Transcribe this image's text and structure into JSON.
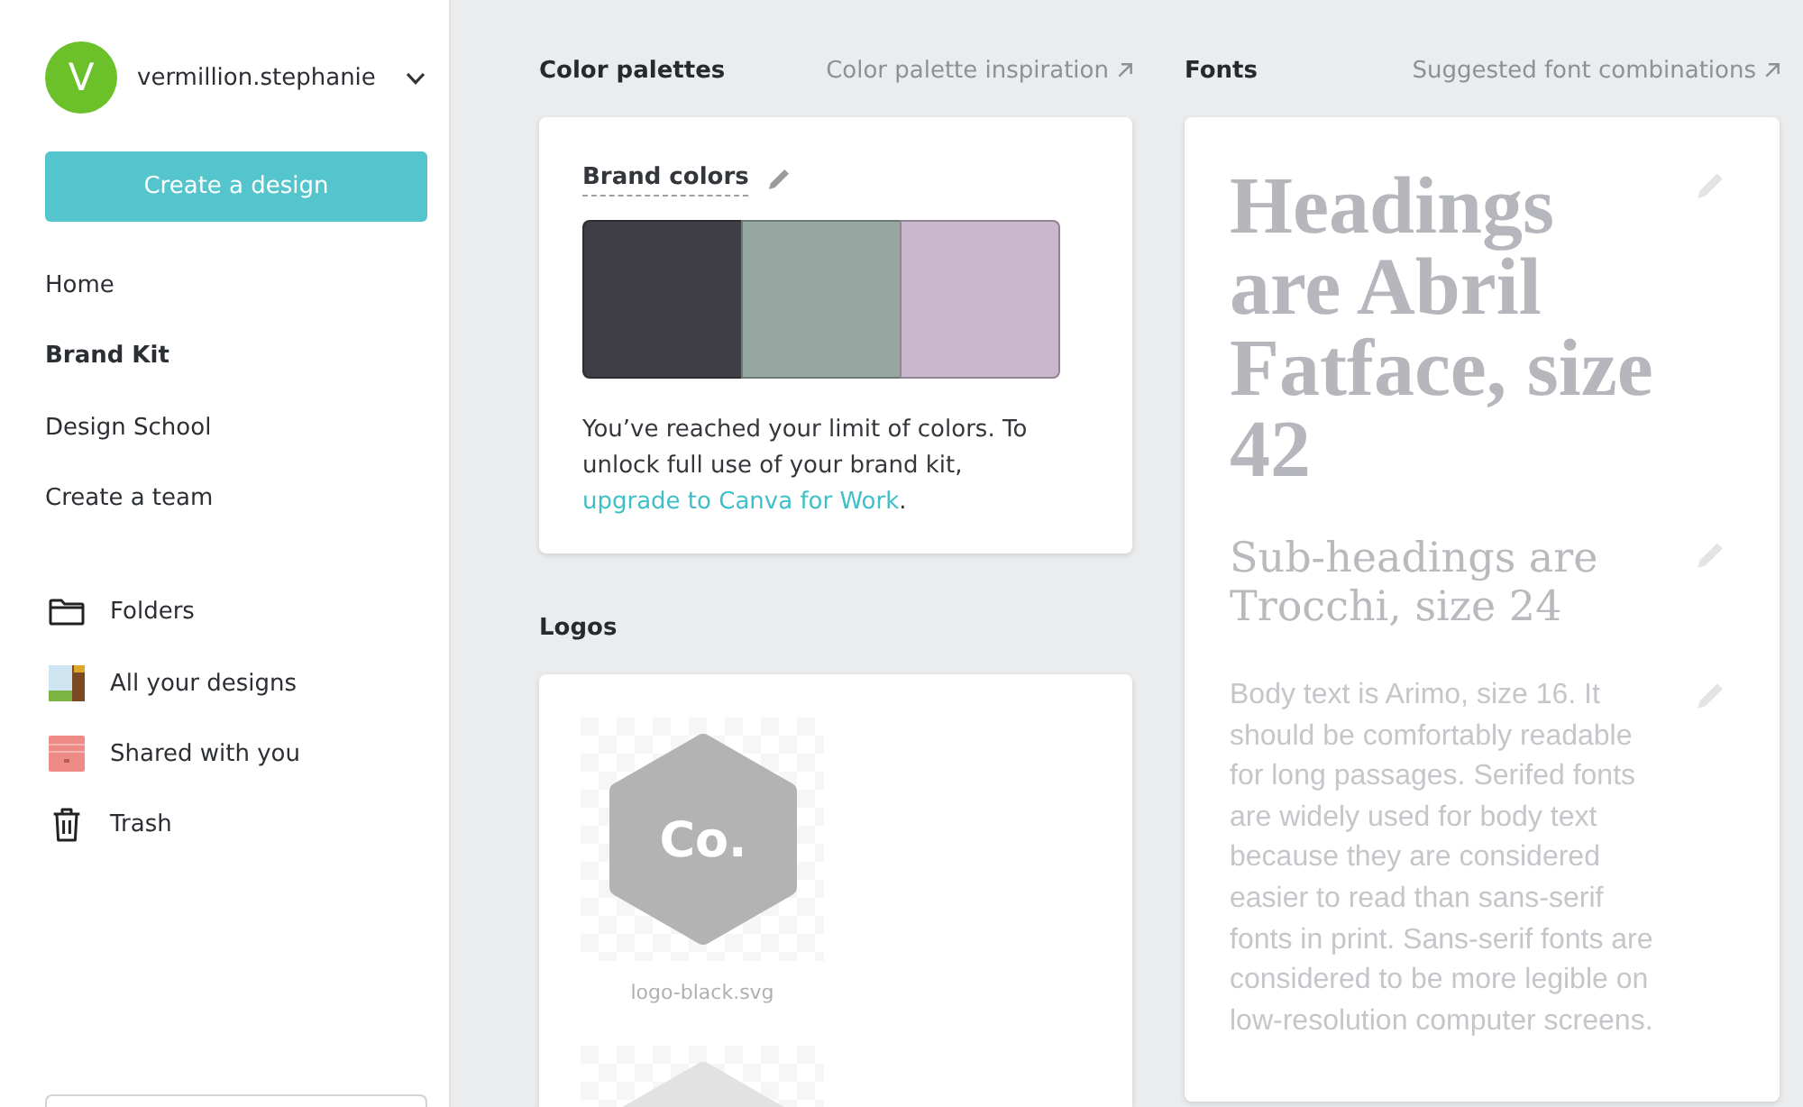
{
  "sidebar": {
    "user": {
      "initial": "V",
      "name": "vermillion.stephanie"
    },
    "create_button": "Create a design",
    "nav": [
      {
        "label": "Home",
        "selected": false
      },
      {
        "label": "Brand Kit",
        "selected": true
      },
      {
        "label": "Design School",
        "selected": false
      },
      {
        "label": "Create a team",
        "selected": false
      }
    ],
    "library": [
      {
        "label": "Folders"
      },
      {
        "label": "All your designs"
      },
      {
        "label": "Shared with you"
      },
      {
        "label": "Trash"
      }
    ]
  },
  "color_palettes": {
    "title": "Color palettes",
    "link": "Color palette inspiration",
    "card": {
      "title": "Brand colors",
      "colors": [
        {
          "color": "#3f3e44"
        },
        {
          "color": "#97a8a2"
        },
        {
          "color": "#c9b8cb"
        }
      ],
      "notice": {
        "text": "You’ve reached your limit of colors. To unlock full use of your brand kit, ",
        "link": "upgrade to Canva for Work",
        "after": "."
      }
    }
  },
  "logos": {
    "title": "Logos",
    "items": [
      {
        "mark": "Co.",
        "caption": "logo-black.svg",
        "color": "#b3b3b3"
      },
      {
        "color": "#e2e2e2"
      }
    ]
  },
  "fonts": {
    "title": "Fonts",
    "link": "Suggested font combinations",
    "samples": [
      {
        "kind": "heading",
        "text": "Headings are Abril Fatface, size 42"
      },
      {
        "kind": "subheading",
        "text": "Sub-headings are Trocchi, size 24"
      },
      {
        "kind": "body",
        "text": "Body text is Arimo, size 16. It should be comfortably readable for long passages. Serifed fonts are widely used for body text because they are considered easier to read than sans-serif fonts in print. Sans-serif fonts are considered to be more legible on low-resolution computer screens."
      }
    ]
  }
}
